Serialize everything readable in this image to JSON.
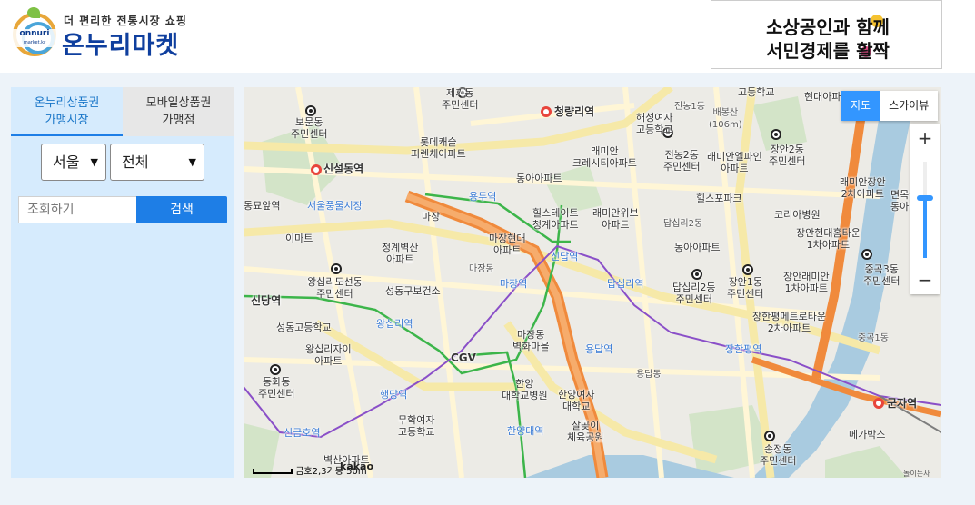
{
  "header": {
    "logo_sub": "더 편리한 전통시장 쇼핑",
    "logo_main": "온누리마켓",
    "logo_en": "onnuri",
    "logo_en_small": "market.kr",
    "banner_line1": "소상공인과 함께",
    "banner_line2": "서민경제를 활짝"
  },
  "panel": {
    "tabs": [
      {
        "label1": "온누리상품권",
        "label2": "가맹시장"
      },
      {
        "label1": "모바일상품권",
        "label2": "가맹점"
      }
    ],
    "region_select": "서울",
    "district_select": "전체",
    "search_placeholder": "조회하기",
    "search_button": "검색"
  },
  "map": {
    "map_type": [
      "지도",
      "스카이뷰"
    ],
    "zoom_in": "+",
    "zoom_out": "−",
    "zoom_level": 0.62,
    "scale": "50m",
    "scale_note": "금호2,3가동",
    "brand": "kakao",
    "copyright": "놀이돈사",
    "labels": [
      {
        "name": "보문동\n주민센터"
      },
      {
        "name": "제기동\n주민센터"
      },
      {
        "name": "청량리역"
      },
      {
        "name": "해성여자\n고등학교"
      },
      {
        "name": "배봉산\n(106m)"
      },
      {
        "name": "현대아파트"
      },
      {
        "name": "고등학교"
      },
      {
        "name": "롯데캐슬\n피렌체아파트"
      },
      {
        "name": "래미안\n크레시티아파트"
      },
      {
        "name": "전농2동\n주민센터"
      },
      {
        "name": "래미안엘파인\n아파트"
      },
      {
        "name": "장안2동\n주민센터"
      },
      {
        "name": "신설동역"
      },
      {
        "name": "동아아파트"
      },
      {
        "name": "래미안장안\n2차아파트"
      },
      {
        "name": "면목늘푸른\n동아아파트"
      },
      {
        "name": "힐스테이트\n청계아파트"
      },
      {
        "name": "래미안위브\n아파트"
      },
      {
        "name": "힐스포파크"
      },
      {
        "name": "코리아병원"
      },
      {
        "name": "동묘앞역"
      },
      {
        "name": "서울풍물시장"
      },
      {
        "name": "용두역"
      },
      {
        "name": "마장"
      },
      {
        "name": "이마트"
      },
      {
        "name": "답십리2동"
      },
      {
        "name": "장안현대홈타운\n1차아파트"
      },
      {
        "name": "마장현대\n아파트"
      },
      {
        "name": "청계벽산\n아파트"
      },
      {
        "name": "동아아파트"
      },
      {
        "name": "왕십리도선동\n주민센터"
      },
      {
        "name": "성동구보건소"
      },
      {
        "name": "마장동"
      },
      {
        "name": "신답역"
      },
      {
        "name": "답십리역"
      },
      {
        "name": "답십리2동\n주민센터"
      },
      {
        "name": "장안1동\n주민센터"
      },
      {
        "name": "장안래미안\n1차아파트"
      },
      {
        "name": "중곡3동\n주민센터"
      },
      {
        "name": "신당역"
      },
      {
        "name": "성동고등학교"
      },
      {
        "name": "마장역"
      },
      {
        "name": "장한평역"
      },
      {
        "name": "장한평메트로타운\n2차아파트"
      },
      {
        "name": "왕십리역"
      },
      {
        "name": "왕십리자이\n아파트"
      },
      {
        "name": "마장동\n벽화마을"
      },
      {
        "name": "CGV"
      },
      {
        "name": "용답역"
      },
      {
        "name": "동화동\n주민센터"
      },
      {
        "name": "행당역"
      },
      {
        "name": "한양\n대학교병원"
      },
      {
        "name": "한양여자\n대학교"
      },
      {
        "name": "신금호역"
      },
      {
        "name": "무학여자\n고등학교"
      },
      {
        "name": "한양대역"
      },
      {
        "name": "살곶이\n체육공원"
      },
      {
        "name": "군자역"
      },
      {
        "name": "메가박스"
      },
      {
        "name": "송정동\n주민센터"
      },
      {
        "name": "벽산아파트"
      },
      {
        "name": "용답동"
      },
      {
        "name": "중곡1동"
      },
      {
        "name": "장안1동"
      },
      {
        "name": "전농1동"
      }
    ]
  }
}
